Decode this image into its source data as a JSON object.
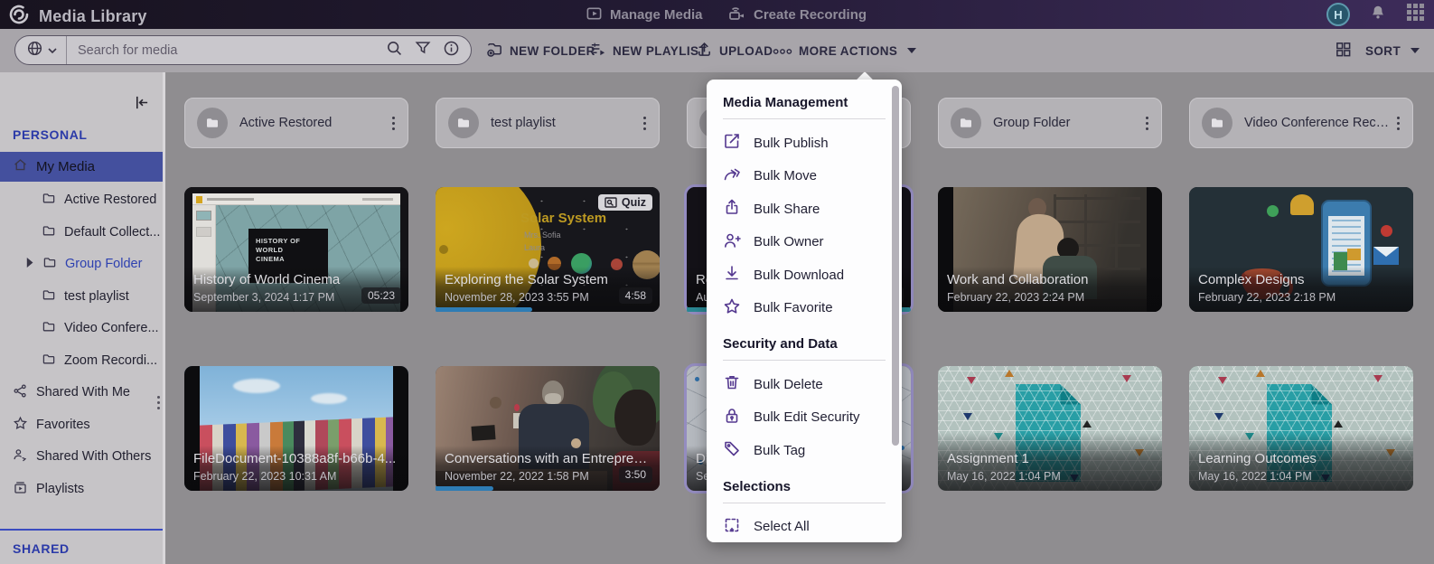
{
  "colors": {
    "accent_purple": "#54388f",
    "sidebar_selected_blue": "#44509e",
    "link_blue": "#2e41b0",
    "progress_blue": "#2e7cb4",
    "progress_teal": "#2b8894",
    "topbar_purple": "#3d2c5a"
  },
  "topbar": {
    "title": "Media Library",
    "manage_media": "Manage Media",
    "create_recording": "Create Recording",
    "avatar_initial": "H"
  },
  "toolbar": {
    "search_placeholder": "Search for media",
    "new_folder": "NEW FOLDER",
    "new_playlist": "NEW PLAYLIST",
    "upload": "UPLOAD",
    "more_actions": "MORE ACTIONS",
    "sort": "SORT"
  },
  "sidebar": {
    "personal_header": "PERSONAL",
    "shared_header": "SHARED",
    "items": [
      {
        "label": "My Media"
      },
      {
        "label": "Active Restored"
      },
      {
        "label": "Default Collect..."
      },
      {
        "label": "Group Folder"
      },
      {
        "label": "test playlist"
      },
      {
        "label": "Video Confere..."
      },
      {
        "label": "Zoom Recordi..."
      },
      {
        "label": "Shared With Me"
      },
      {
        "label": "Favorites"
      },
      {
        "label": "Shared With Others"
      },
      {
        "label": "Playlists"
      }
    ]
  },
  "folder_cards": [
    {
      "name": "Active Restored"
    },
    {
      "name": "test playlist"
    },
    {
      "name": ""
    },
    {
      "name": "Group Folder"
    },
    {
      "name": "Video Conference Record..."
    }
  ],
  "media_cards": {
    "row1": [
      {
        "title": "History of World Cinema",
        "date": "September 3, 2024 1:17 PM",
        "duration": "05:23",
        "slide_text": "HISTORY OF\nWORLD\nCINEMA"
      },
      {
        "title": "Exploring the Solar System",
        "date": "November 28, 2023 3:55 PM",
        "duration": "4:58",
        "badge": "Quiz",
        "progress": 43,
        "thumb_title": "Solar System",
        "thumb_sub": "Mrs. Sofia\nLaura"
      },
      {
        "title": "Re",
        "date": "Au",
        "progress": 100
      },
      {
        "title": "Work and Collaboration",
        "date": "February 22, 2023 2:24 PM"
      },
      {
        "title": "Complex Designs",
        "date": "February 22, 2023 2:18 PM"
      }
    ],
    "row2": [
      {
        "title": "FileDocument-10388a8f-b66b-4...",
        "date": "February 22, 2023 10:31 AM"
      },
      {
        "title": "Conversations with an Entrepren...",
        "date": "November 22, 2022 1:58 PM",
        "duration": "3:50",
        "progress": 26
      },
      {
        "title": "Di",
        "date": "Se"
      },
      {
        "title": "Assignment 1",
        "date": "May 16, 2022 1:04 PM"
      },
      {
        "title": "Learning Outcomes",
        "date": "May 16, 2022 1:04 PM"
      }
    ]
  },
  "menu": {
    "sections": [
      {
        "title": "Media Management",
        "items": [
          {
            "label": "Bulk Publish"
          },
          {
            "label": "Bulk Move"
          },
          {
            "label": "Bulk Share"
          },
          {
            "label": "Bulk Owner"
          },
          {
            "label": "Bulk Download"
          },
          {
            "label": "Bulk Favorite"
          }
        ]
      },
      {
        "title": "Security and Data",
        "items": [
          {
            "label": "Bulk Delete"
          },
          {
            "label": "Bulk Edit Security"
          },
          {
            "label": "Bulk Tag"
          }
        ]
      },
      {
        "title": "Selections",
        "items": [
          {
            "label": "Select All"
          }
        ]
      }
    ]
  }
}
